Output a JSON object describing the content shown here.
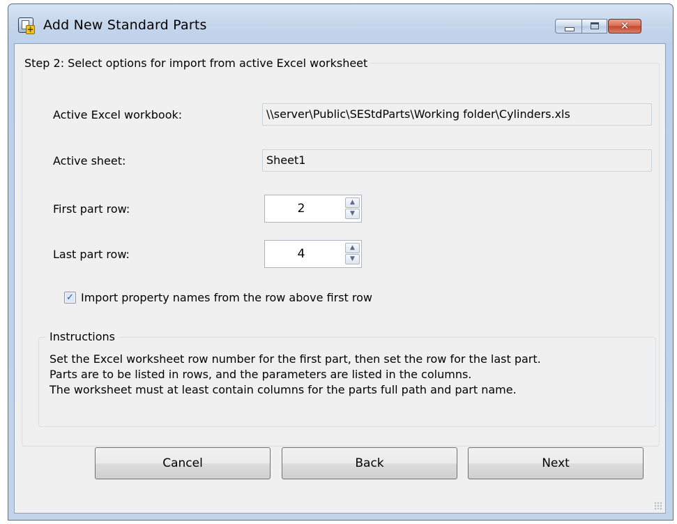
{
  "window": {
    "title": "Add New Standard Parts",
    "controls": {
      "minimize": "minimize-button",
      "maximize": "maximize-button",
      "close": "✕"
    }
  },
  "step": {
    "legend": "Step 2: Select options for import from active Excel worksheet",
    "workbook_label": "Active Excel workbook:",
    "workbook_value": "\\\\server\\Public\\SEStdParts\\Working folder\\Cylinders.xls",
    "sheet_label": "Active sheet:",
    "sheet_value": "Sheet1",
    "first_row_label": "First part row:",
    "first_row_value": "2",
    "last_row_label": "Last part row:",
    "last_row_value": "4",
    "import_names_label": "Import property names from the row above first row",
    "import_names_checked": true
  },
  "instructions": {
    "legend": "Instructions",
    "text": "Set the Excel worksheet row number for the first part, then set the row for the last part.\nParts are to be listed in rows, and the parameters are listed in the columns.\nThe worksheet must at least contain columns for the parts full path and part name."
  },
  "buttons": {
    "cancel": "Cancel",
    "back": "Back",
    "next": "Next"
  }
}
